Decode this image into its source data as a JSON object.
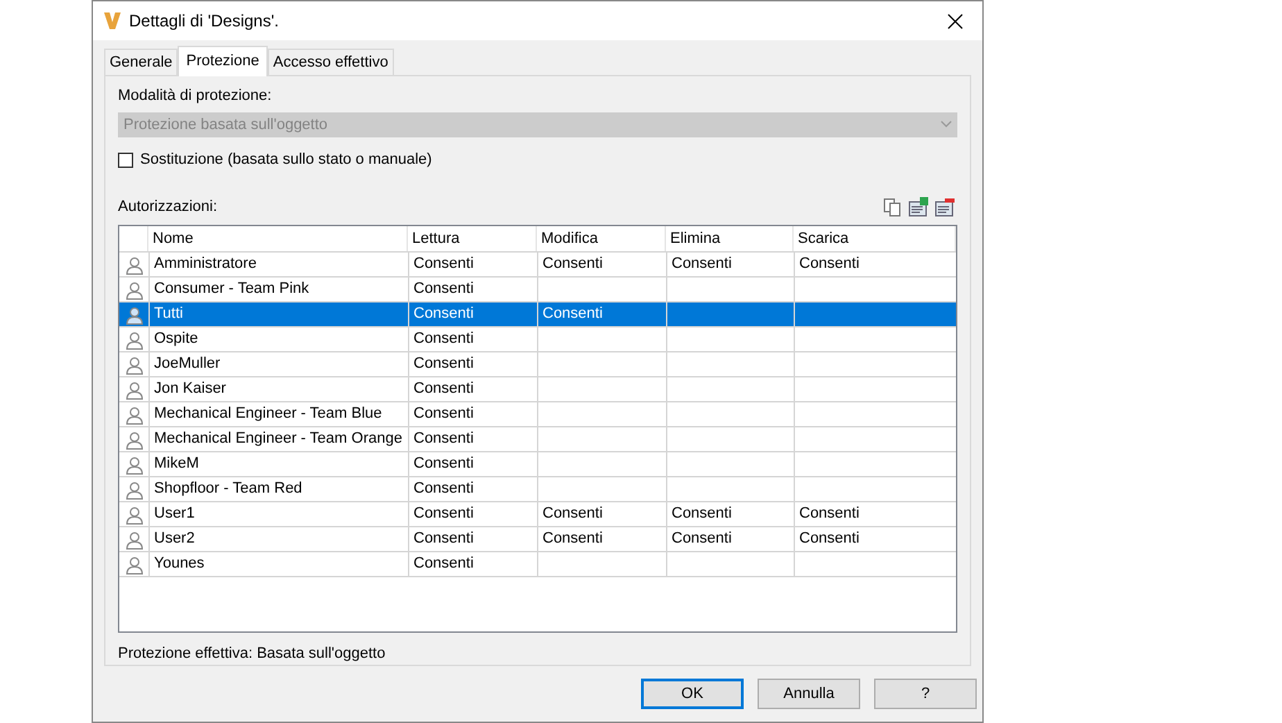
{
  "window": {
    "title": "Dettagli di 'Designs'."
  },
  "tabs": [
    {
      "label": "Generale",
      "selected": false
    },
    {
      "label": "Protezione",
      "selected": true
    },
    {
      "label": "Accesso effettivo",
      "selected": false
    }
  ],
  "mode": {
    "label": "Modalità di protezione:",
    "value": "Protezione basata sull'oggetto",
    "disabled": true
  },
  "override": {
    "label": "Sostituzione (basata sullo stato o manuale)",
    "checked": false
  },
  "permissions": {
    "label": "Autorizzazioni:",
    "columns": [
      "Nome",
      "Lettura",
      "Modifica",
      "Elimina",
      "Scarica"
    ],
    "rows": [
      {
        "name": "Amministratore",
        "selected": false,
        "read": "Consenti",
        "modify": "Consenti",
        "delete": "Consenti",
        "download": "Consenti"
      },
      {
        "name": "Consumer - Team Pink",
        "selected": false,
        "read": "Consenti"
      },
      {
        "name": "Tutti",
        "selected": true,
        "read": "Consenti",
        "modify": "Consenti"
      },
      {
        "name": "Ospite",
        "selected": false,
        "read": "Consenti"
      },
      {
        "name": "JoeMuller",
        "selected": false,
        "read": "Consenti"
      },
      {
        "name": "Jon Kaiser",
        "selected": false,
        "read": "Consenti"
      },
      {
        "name": "Mechanical Engineer - Team Blue",
        "selected": false,
        "read": "Consenti"
      },
      {
        "name": "Mechanical Engineer - Team Orange",
        "selected": false,
        "read": "Consenti"
      },
      {
        "name": "MikeM",
        "selected": false,
        "read": "Consenti"
      },
      {
        "name": "Shopfloor - Team Red",
        "selected": false,
        "read": "Consenti"
      },
      {
        "name": "User1",
        "selected": false,
        "read": "Consenti",
        "modify": "Consenti",
        "delete": "Consenti",
        "download": "Consenti"
      },
      {
        "name": "User2",
        "selected": false,
        "read": "Consenti",
        "modify": "Consenti",
        "delete": "Consenti",
        "download": "Consenti"
      },
      {
        "name": "Younes",
        "selected": false,
        "read": "Consenti"
      }
    ]
  },
  "effective": "Protezione effettiva: Basata sull'oggetto",
  "buttons": [
    "OK",
    "Annulla",
    "?"
  ]
}
